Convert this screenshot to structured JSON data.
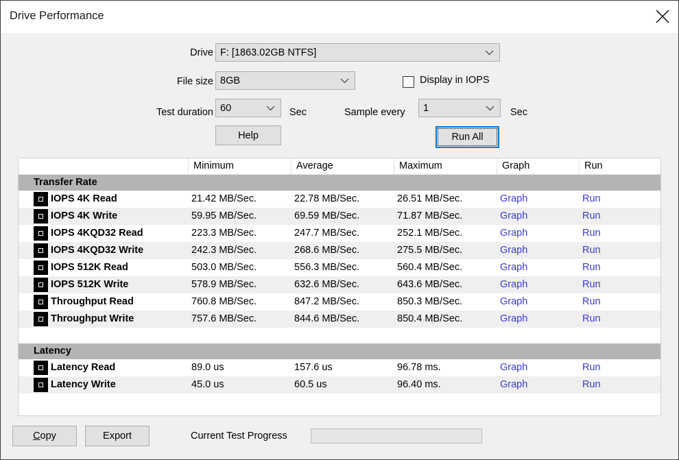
{
  "window": {
    "title": "Drive Performance",
    "close_icon": "close-icon"
  },
  "form": {
    "drive_label": "Drive",
    "drive_value": "F: [1863.02GB NTFS]",
    "filesize_label": "File size",
    "filesize_value": "8GB",
    "duration_label": "Test duration",
    "duration_value": "60",
    "duration_unit": "Sec",
    "sample_label": "Sample every",
    "sample_value": "1",
    "sample_unit": "Sec",
    "display_iops_label": "Display in IOPS",
    "display_iops_checked": false,
    "help_label": "Help",
    "run_all_label": "Run All"
  },
  "table": {
    "columns": [
      "",
      "Minimum",
      "Average",
      "Maximum",
      "Graph",
      "Run"
    ],
    "sections": [
      {
        "title": "Transfer Rate",
        "rows": [
          {
            "name": "IOPS 4K Read",
            "minimum": "21.42 MB/Sec.",
            "average": "22.78 MB/Sec.",
            "maximum": "26.51 MB/Sec.",
            "graph": "Graph",
            "run": "Run"
          },
          {
            "name": "IOPS 4K Write",
            "minimum": "59.95 MB/Sec.",
            "average": "69.59 MB/Sec.",
            "maximum": "71.87 MB/Sec.",
            "graph": "Graph",
            "run": "Run"
          },
          {
            "name": "IOPS 4KQD32 Read",
            "minimum": "223.3 MB/Sec.",
            "average": "247.7 MB/Sec.",
            "maximum": "252.1 MB/Sec.",
            "graph": "Graph",
            "run": "Run"
          },
          {
            "name": "IOPS 4KQD32 Write",
            "minimum": "242.3 MB/Sec.",
            "average": "268.6 MB/Sec.",
            "maximum": "275.5 MB/Sec.",
            "graph": "Graph",
            "run": "Run"
          },
          {
            "name": "IOPS 512K Read",
            "minimum": "503.0 MB/Sec.",
            "average": "556.3 MB/Sec.",
            "maximum": "560.4 MB/Sec.",
            "graph": "Graph",
            "run": "Run"
          },
          {
            "name": "IOPS 512K Write",
            "minimum": "578.9 MB/Sec.",
            "average": "632.6 MB/Sec.",
            "maximum": "643.6 MB/Sec.",
            "graph": "Graph",
            "run": "Run"
          },
          {
            "name": "Throughput Read",
            "minimum": "760.8 MB/Sec.",
            "average": "847.2 MB/Sec.",
            "maximum": "850.3 MB/Sec.",
            "graph": "Graph",
            "run": "Run"
          },
          {
            "name": "Throughput Write",
            "minimum": "757.6 MB/Sec.",
            "average": "844.6 MB/Sec.",
            "maximum": "850.4 MB/Sec.",
            "graph": "Graph",
            "run": "Run"
          }
        ]
      },
      {
        "title": "Latency",
        "rows": [
          {
            "name": "Latency Read",
            "minimum": "89.0 us",
            "average": "157.6 us",
            "maximum": "96.78 ms.",
            "graph": "Graph",
            "run": "Run"
          },
          {
            "name": "Latency Write",
            "minimum": "45.0 us",
            "average": "60.5 us",
            "maximum": "96.40 ms.",
            "graph": "Graph",
            "run": "Run"
          }
        ]
      }
    ]
  },
  "footer": {
    "copy_label": "Copy",
    "copy_accel": "C",
    "copy_rest": "opy",
    "export_label": "Export",
    "progress_label": "Current Test Progress",
    "progress_value": 0
  },
  "colors": {
    "link": "#3a3ad0",
    "focus": "#0078d7",
    "section_header": "#b4b4b4",
    "row_alt": "#efefef",
    "window_bg": "#f0f0f0"
  }
}
